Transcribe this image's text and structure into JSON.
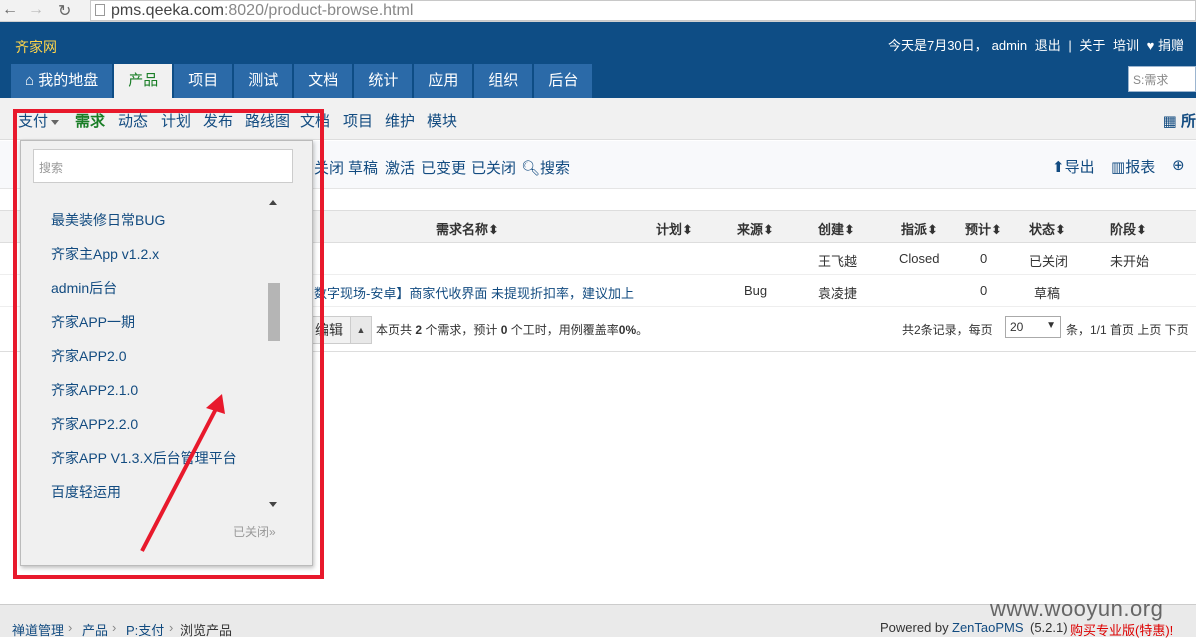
{
  "browser": {
    "url_main": "pms.qeeka.com",
    "url_rest": ":8020/product-browse.html"
  },
  "header": {
    "brand": "齐家网",
    "date_text": "今天是7月30日，",
    "user": "admin",
    "logout": "退出",
    "sep": "|",
    "about": "关于",
    "training": "培训",
    "donate": "♥ 捐赠"
  },
  "mainnav": {
    "home": "我的地盘",
    "tabs": [
      "产品",
      "项目",
      "测试",
      "文档",
      "统计",
      "应用",
      "组织",
      "后台"
    ]
  },
  "quicksearch": {
    "placeholder": "S:需求"
  },
  "subnav": {
    "product": "支付",
    "items": [
      "需求",
      "动态",
      "计划",
      "发布",
      "路线图",
      "文档",
      "项目",
      "维护",
      "模块"
    ],
    "all": "所"
  },
  "featurebar": {
    "filters": [
      "关闭",
      "草稿",
      "激活",
      "已变更",
      "已关闭"
    ],
    "search": "搜索",
    "export": "导出",
    "report": "报表"
  },
  "table": {
    "headers": [
      "需求名称",
      "计划",
      "来源",
      "创建",
      "指派",
      "预计",
      "状态",
      "阶段"
    ],
    "rows": [
      {
        "title": "",
        "plan": "",
        "source": "",
        "creator": "王飞越",
        "assigned": "Closed",
        "estimate": "0",
        "status": "已关闭",
        "stage": "未开始"
      },
      {
        "title": "数字现场-安卓】商家代收界面 未提现折扣率，建议加上",
        "plan": "",
        "source": "Bug",
        "creator": "袁凌捷",
        "assigned": "",
        "estimate": "0",
        "status": "草稿",
        "stage": ""
      }
    ]
  },
  "footer": {
    "edit": "编辑",
    "summary_pre": "本页共",
    "summary_count": "2",
    "summary_mid": "个需求，预计",
    "summary_hours": "0",
    "summary_post": "个工时，用例覆盖率",
    "summary_rate": "0%",
    "summary_end": "。",
    "records": "共2条记录，每页",
    "pagesize": "20",
    "pager": "条，1/1 首页 上页 下页"
  },
  "dropdown": {
    "search_placeholder": "搜索",
    "items": [
      "最美装修日常BUG",
      "齐家主App v1.2.x",
      "admin后台",
      "齐家APP一期",
      "齐家APP2.0",
      "齐家APP2.1.0",
      "齐家APP2.2.0",
      "齐家APP V1.3.X后台管理平台",
      "百度轻运用"
    ],
    "closed": "已关闭»"
  },
  "breadcrumb": {
    "items": [
      "禅道管理",
      "产品",
      "P:支付",
      "浏览产品"
    ],
    "powered": "Powered by",
    "zentao": "ZenTaoPMS",
    "version": "(5.2.1)",
    "buy": "购买专业版(特惠)!"
  },
  "watermark": "www.wooyun.org",
  "colors": {
    "header_bg": "#0e4d85",
    "tab_bg": "#2b6aa8",
    "link": "#124b80",
    "active_green": "#1a7e27",
    "highlight_red": "#e8192c",
    "brand_yellow": "#ffd54a"
  }
}
